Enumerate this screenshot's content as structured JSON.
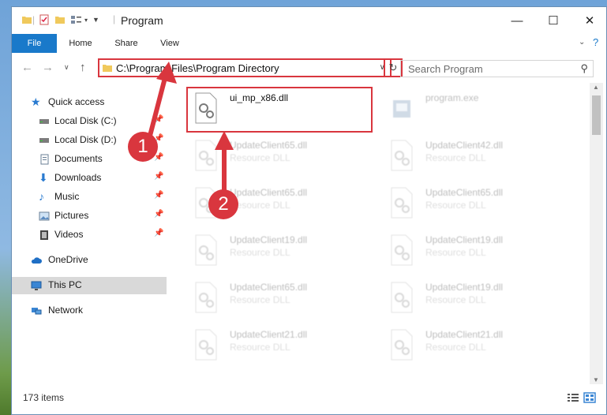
{
  "window": {
    "title": "Program"
  },
  "ribbon": {
    "tabs": [
      "File",
      "Home",
      "Share",
      "View"
    ]
  },
  "address": {
    "path": "C:\\Program Files\\Program Directory"
  },
  "search": {
    "placeholder": "Search Program"
  },
  "sidebar": {
    "items": [
      {
        "label": "Quick access",
        "icon": "star-icon"
      },
      {
        "label": "Local Disk (C:)",
        "icon": "drive-icon",
        "pinned": true
      },
      {
        "label": "Local Disk (D:)",
        "icon": "drive-icon",
        "pinned": true
      },
      {
        "label": "Documents",
        "icon": "documents-icon",
        "pinned": true
      },
      {
        "label": "Downloads",
        "icon": "downloads-icon",
        "pinned": true
      },
      {
        "label": "Music",
        "icon": "music-icon",
        "pinned": true
      },
      {
        "label": "Pictures",
        "icon": "pictures-icon",
        "pinned": true
      },
      {
        "label": "Videos",
        "icon": "videos-icon",
        "pinned": true
      },
      {
        "label": "OneDrive",
        "icon": "cloud-icon"
      },
      {
        "label": "This PC",
        "icon": "pc-icon",
        "selected": true
      },
      {
        "label": "Network",
        "icon": "network-icon"
      }
    ]
  },
  "files": {
    "highlighted": {
      "name": "ui_mp_x86.dll"
    },
    "program": {
      "name": "program.exe"
    },
    "ghosts": [
      {
        "name": "UpdateClient65.dll",
        "type": "Resource DLL"
      },
      {
        "name": "UpdateClient42.dll",
        "type": "Resource DLL"
      },
      {
        "name": "UpdateClient65.dll",
        "type": "Resource DLL"
      },
      {
        "name": "UpdateClient65.dll",
        "type": "Resource DLL"
      },
      {
        "name": "UpdateClient19.dll",
        "type": "Resource DLL"
      },
      {
        "name": "UpdateClient19.dll",
        "type": "Resource DLL"
      },
      {
        "name": "UpdateClient65.dll",
        "type": "Resource DLL"
      },
      {
        "name": "UpdateClient19.dll",
        "type": "Resource DLL"
      },
      {
        "name": "UpdateClient21.dll",
        "type": "Resource DLL"
      },
      {
        "name": "UpdateClient21.dll",
        "type": "Resource DLL"
      }
    ]
  },
  "status": {
    "count": "173 items"
  },
  "callouts": [
    "1",
    "2"
  ],
  "colors": {
    "accent": "#1979ca",
    "highlight": "#d9363e"
  }
}
